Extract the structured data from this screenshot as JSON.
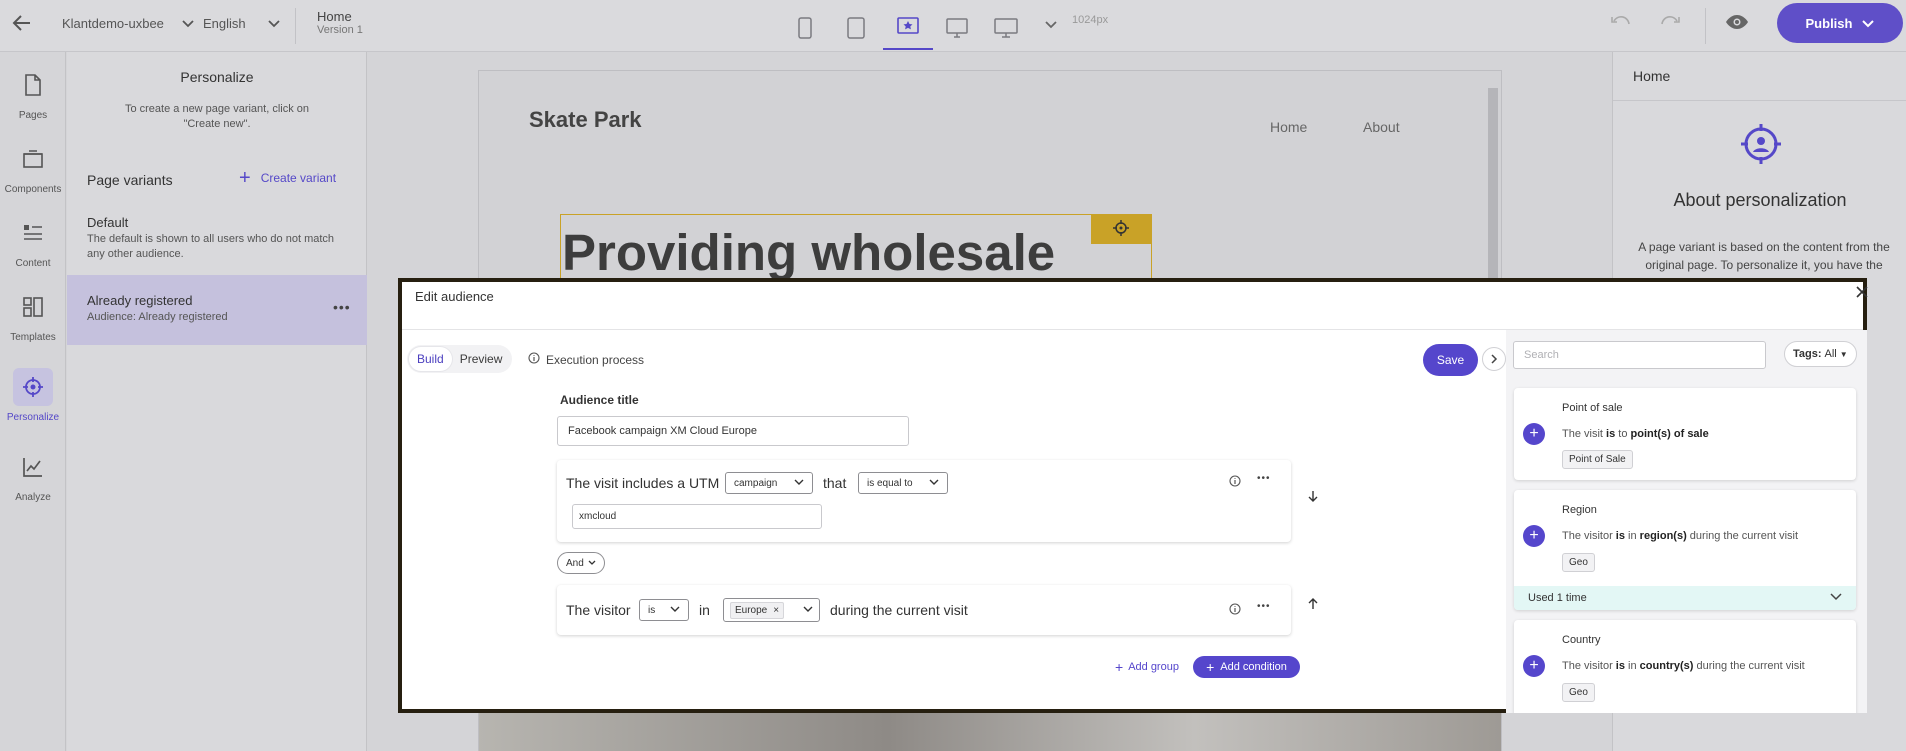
{
  "topbar": {
    "site": "Klantdemo-uxbee",
    "language": "English",
    "page_title": "Home",
    "page_version": "Version 1",
    "viewport": "1024px",
    "publish_label": "Publish"
  },
  "rail": {
    "items": [
      {
        "label": "Pages"
      },
      {
        "label": "Components"
      },
      {
        "label": "Content"
      },
      {
        "label": "Templates"
      },
      {
        "label": "Personalize"
      },
      {
        "label": "Analyze"
      }
    ]
  },
  "personalize": {
    "title": "Personalize",
    "hint": "To create a new page variant, click on \"Create new\".",
    "variants_heading": "Page variants",
    "create_label": "Create variant",
    "variants": [
      {
        "name": "Default",
        "description": "The default is shown to all users who do not match any other audience."
      },
      {
        "name": "Already registered",
        "description": "Audience: Already registered"
      }
    ]
  },
  "canvas": {
    "site_name": "Skate Park",
    "nav": [
      "Home",
      "About"
    ],
    "hero_heading": "Providing wholesale"
  },
  "right_panel": {
    "title": "Home",
    "heading": "About personalization",
    "text": "A page variant is based on the content from the original page. To personalize it, you have the"
  },
  "modal": {
    "title": "Edit audience",
    "tabs": [
      "Build",
      "Preview"
    ],
    "execution_label": "Execution process",
    "save_label": "Save",
    "audience_title_label": "Audience title",
    "audience_title_value": "Facebook campaign XM Cloud Europe",
    "condition1": {
      "prefix": "The visit includes a UTM",
      "param": "campaign",
      "joiner": "that",
      "operator": "is equal to",
      "value": "xmcloud"
    },
    "and_label": "And",
    "condition2": {
      "prefix": "The visitor",
      "operator": "is",
      "joiner": "in",
      "value_tag": "Europe",
      "suffix": "during the current visit"
    },
    "add_group_label": "Add group",
    "add_condition_label": "Add condition",
    "search_placeholder": "Search",
    "tags_label": "Tags:",
    "tags_value": "All",
    "rules": [
      {
        "title": "Point of sale",
        "text_a": "The visit ",
        "text_b": "is",
        "text_c": " to ",
        "text_d": "point(s) of sale",
        "text_e": "",
        "tag": "Point of Sale"
      },
      {
        "title": "Region",
        "text_a": "The visitor ",
        "text_b": "is",
        "text_c": " in ",
        "text_d": "region(s)",
        "text_e": " during the current visit",
        "tag": "Geo",
        "usage": "Used 1 time"
      },
      {
        "title": "Country",
        "text_a": "The visitor ",
        "text_b": "is",
        "text_c": " in ",
        "text_d": "country(s)",
        "text_e": " during the current visit",
        "tag": "Geo"
      }
    ]
  }
}
